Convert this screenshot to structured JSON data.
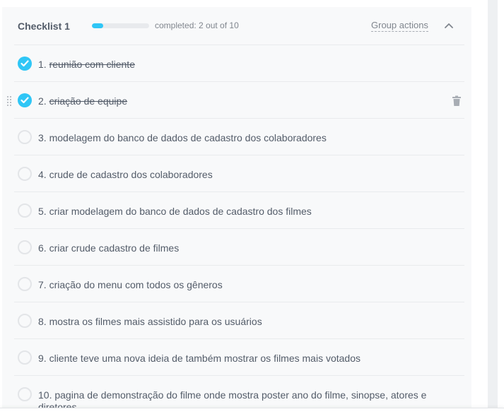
{
  "checklist": {
    "title": "Checklist 1",
    "progress_fraction": 0.2,
    "completed_text": "completed: 2 out of 10",
    "group_actions_label": "Group actions",
    "collapse_icon": "chevron-up-icon"
  },
  "items": [
    {
      "number": "1.",
      "text": "reunião com cliente",
      "done": true
    },
    {
      "number": "2.",
      "text": "criação de equipe",
      "done": true,
      "hovered": true
    },
    {
      "number": "3.",
      "text": "modelagem do banco de dados de cadastro dos colaboradores",
      "done": false
    },
    {
      "number": "4.",
      "text": "crude de cadastro dos colaboradores",
      "done": false
    },
    {
      "number": "5.",
      "text": "criar modelagem do banco de dados de cadastro dos filmes",
      "done": false
    },
    {
      "number": "6.",
      "text": "criar crude cadastro de filmes",
      "done": false
    },
    {
      "number": "7.",
      "text": "criação do menu com todos os gêneros",
      "done": false
    },
    {
      "number": "8.",
      "text": "mostra os filmes mais assistido para os usuários",
      "done": false
    },
    {
      "number": "9.",
      "text": "cliente teve uma nova ideia de também mostrar os filmes mais votados",
      "done": false
    },
    {
      "number": "10.",
      "text": "pagina de demonstração do filme onde mostra poster ano do filme, sinopse, atores e diretores",
      "done": false
    }
  ],
  "colors": {
    "accent": "#2fc6f6",
    "text": "#535c69",
    "muted": "#80868e",
    "panel": "#f8f9fa"
  }
}
